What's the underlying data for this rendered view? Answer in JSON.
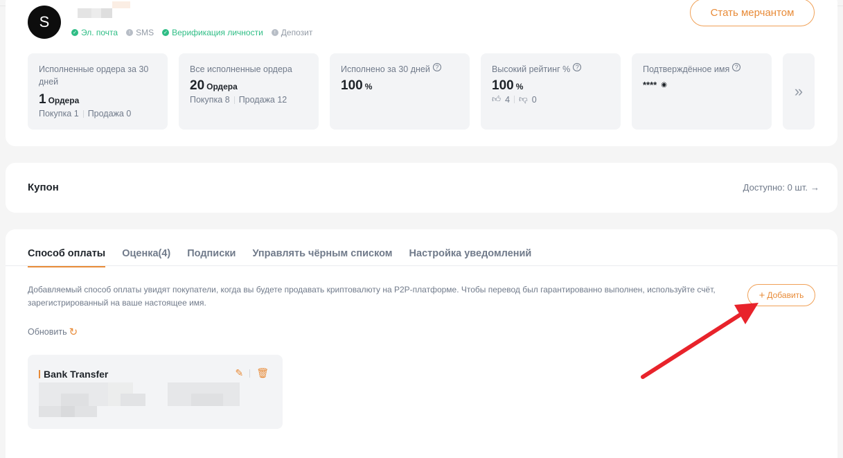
{
  "profile": {
    "avatar_letter": "S",
    "verifications": [
      {
        "label": "Эл. почта",
        "verified": true
      },
      {
        "label": "SMS",
        "verified": false
      },
      {
        "label": "Верификация личности",
        "verified": true
      },
      {
        "label": "Депозит",
        "verified": false
      }
    ],
    "merchant_button": "Стать мерчантом"
  },
  "stats": {
    "orders30": {
      "label": "Исполненные ордера за 30 дней",
      "value": "1",
      "unit": "Ордера",
      "buy": "Покупка 1",
      "sell": "Продажа 0"
    },
    "orders_all": {
      "label": "Все исполненные ордера",
      "value": "20",
      "unit": "Ордера",
      "buy": "Покупка 8",
      "sell": "Продажа 12"
    },
    "completion": {
      "label": "Исполнено за 30 дней",
      "value": "100",
      "unit": "%"
    },
    "rating": {
      "label": "Высокий рейтинг %",
      "value": "100",
      "unit": "%",
      "likes": "4",
      "dislikes": "0"
    },
    "verified_name": {
      "label": "Подтверждённое имя",
      "value": "****"
    },
    "next": "»"
  },
  "coupon": {
    "title": "Купон",
    "available": "Доступно: 0 шт."
  },
  "tabs": [
    {
      "label": "Способ оплаты",
      "active": true
    },
    {
      "label": "Оценка(4)",
      "active": false
    },
    {
      "label": "Подписки",
      "active": false
    },
    {
      "label": "Управлять чёрным списком",
      "active": false
    },
    {
      "label": "Настройка уведомлений",
      "active": false
    }
  ],
  "payment": {
    "description": "Добавляемый способ оплаты увидят покупатели, когда вы будете продавать криптовалюту на P2P-платформе. Чтобы перевод был гарантированно выполнен, используйте счёт, зарегистрированный на ваше настоящее имя.",
    "add_button": "Добавить",
    "refresh": "Обновить",
    "methods": [
      {
        "name": "Bank Transfer"
      }
    ]
  },
  "colors": {
    "accent": "#e88b38",
    "success": "#2ebd85",
    "annotation": "#e8232b"
  }
}
